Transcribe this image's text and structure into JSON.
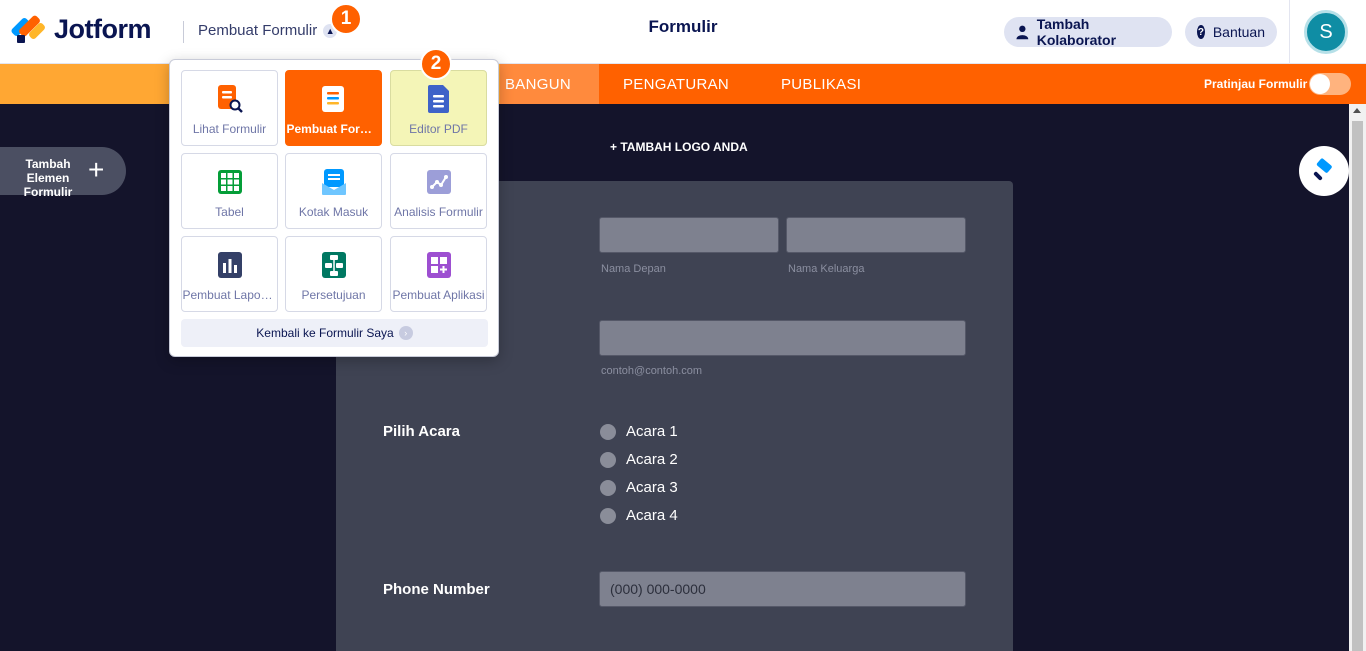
{
  "header": {
    "brand": "Jotform",
    "builder_menu": "Pembuat Formulir",
    "title": "Formulir",
    "collaborator_button": "Tambah Kolaborator",
    "help_button": "Bantuan",
    "avatar_initial": "S"
  },
  "nav": {
    "tabs": [
      {
        "label": "BANGUN",
        "active": true
      },
      {
        "label": "PENGATURAN",
        "active": false
      },
      {
        "label": "PUBLIKASI",
        "active": false
      }
    ],
    "preview_label": "Pratinjau Formulir",
    "preview_enabled": false
  },
  "sidebar": {
    "add_element_label": "Tambah Elemen Formulir"
  },
  "canvas": {
    "add_logo": "+ TAMBAH LOGO ANDA",
    "name_first_sublabel": "Nama Depan",
    "name_last_sublabel": "Nama Keluarga",
    "email_sublabel": "contoh@contoh.com",
    "event_label": "Pilih Acara",
    "events": [
      "Acara 1",
      "Acara 2",
      "Acara 3",
      "Acara 4"
    ],
    "phone_label": "Phone Number",
    "phone_placeholder": "(000) 000-0000"
  },
  "dropdown": {
    "tiles": [
      {
        "label": "Lihat Formulir",
        "icon": "view-form-icon"
      },
      {
        "label": "Pembuat Formulir",
        "icon": "form-builder-icon",
        "selected": true
      },
      {
        "label": "Editor PDF",
        "icon": "pdf-editor-icon",
        "highlighted": true
      },
      {
        "label": "Tabel",
        "icon": "tables-icon"
      },
      {
        "label": "Kotak Masuk",
        "icon": "inbox-icon"
      },
      {
        "label": "Analisis Formulir",
        "icon": "analytics-icon"
      },
      {
        "label": "Pembuat Laporan",
        "icon": "report-builder-icon"
      },
      {
        "label": "Persetujuan",
        "icon": "approvals-icon"
      },
      {
        "label": "Pembuat Aplikasi",
        "icon": "app-builder-icon"
      }
    ],
    "back_link": "Kembali ke Formulir Saya"
  },
  "badges": [
    "1",
    "2"
  ],
  "colors": {
    "brand_orange": "#ff6100",
    "navy": "#0a1551",
    "canvas_bg": "#14142b",
    "form_bg": "#3f4353",
    "highlight": "#f4f5b7"
  }
}
